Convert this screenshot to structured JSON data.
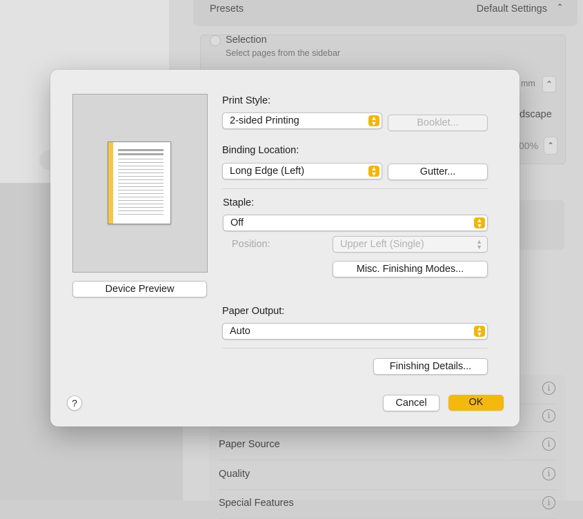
{
  "background": {
    "presets_label": "Presets",
    "presets_value": "Default Settings",
    "selection_label": "Selection",
    "selection_sub": "Select pages from the sidebar",
    "unit_fragment": "mm",
    "orientation_fragment": "dscape",
    "scale_fragment": "00%",
    "list_items": [
      "Paper Source",
      "Quality",
      "Special Features"
    ]
  },
  "dialog": {
    "preview_button": "Device Preview",
    "print_style_label": "Print Style:",
    "print_style_value": "2-sided Printing",
    "booklet_button": "Booklet...",
    "binding_label": "Binding Location:",
    "binding_value": "Long Edge (Left)",
    "gutter_button": "Gutter...",
    "staple_label": "Staple:",
    "staple_value": "Off",
    "position_label": "Position:",
    "position_value": "Upper Left (Single)",
    "misc_button": "Misc. Finishing Modes...",
    "paper_output_label": "Paper Output:",
    "paper_output_value": "Auto",
    "finishing_details_button": "Finishing Details...",
    "help_button": "?",
    "cancel_button": "Cancel",
    "ok_button": "OK"
  },
  "colors": {
    "accent": "#f5b80f",
    "binding_edge": "#f7c744"
  },
  "icons": {
    "popup_chevron": "up-down-chevron-icon",
    "info": "info-icon"
  }
}
